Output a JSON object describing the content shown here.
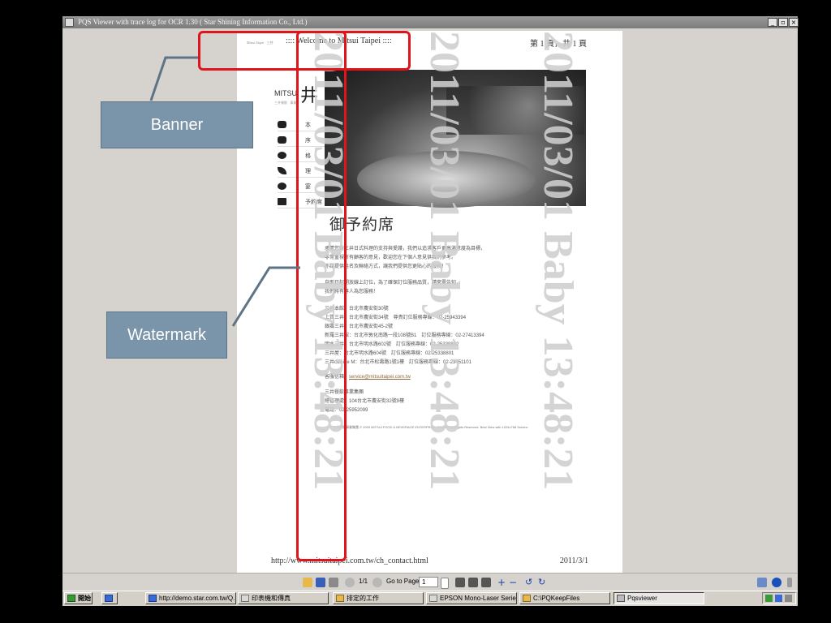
{
  "window": {
    "title": "PQS Viewer with trace log for OCR 1.30 ( Star Shining Information Co., Ltd.)",
    "min": "_",
    "max": "▫",
    "close": "×"
  },
  "document": {
    "welcome": ":::: Welcome to Mitsui Taipei ::::",
    "top_left_text": "Mitsui Taipei · 三井",
    "page_indicator": "第 1 頁，共 1 頁",
    "logo_text": "MITSU",
    "logo_kanji": "井",
    "logo_subtext": "三井餐飲 · 事業",
    "nav_items": [
      {
        "icon": "dish-icon",
        "label": "本"
      },
      {
        "icon": "hand-icon",
        "label": "序"
      },
      {
        "icon": "circle-icon",
        "label": "格"
      },
      {
        "icon": "leaf-icon",
        "label": "理"
      },
      {
        "icon": "ball-icon",
        "label": "宴"
      },
      {
        "icon": "card-icon",
        "label": "予約席"
      }
    ],
    "section_title": "御予約席",
    "paragraphs": [
      "承蒙您對三井日式料理的支持與愛護，我們以追求客戶更高滿意度為目標，",
      "非常重視所有顧客的意見，歡迎您在下個人意見供我們參考。",
      "亦請提供姓名及聯絡方式，讓我們提供您更貼心的服務！",
      "",
      "自即日起開放線上訂位，為了確保訂位服務品質，請來電告知，",
      "我們將有專人為您服務！",
      "",
      "三井本館：台北市農安街30號",
      "上質三井：台北市農安街34號　尊貴訂位服務專線：02-25943394",
      "銀壽三井：台北市農安街45-2號",
      "新羅三井館：台北市敦化南路一段108號B1　訂位服務專線：02-27413394",
      "明水三井：台北市明水路602號　訂位服務專線：02-25338802",
      "三井屋：台北市明水路604號　訂位服務專線：02-25338801",
      "三井cuisine M：台北市松壽路1號1樓　訂位服務專線：02-23451101"
    ],
    "service_label": "客服信箱：",
    "service_email": "service@mitsuitaipei.com.tw",
    "company_lines": [
      "三井餐飲事業集團",
      "總管理處：104台北市農安街32號9樓",
      "電話：02-25952099"
    ],
    "copyright": "三井餐飲事業集團 © 2009 MITSUI FOOD & BEVERAGE ENTERPRISE GROUP. All Rights Reserved. Best View with 1024x768 Screen.",
    "footer_url": "http://www.mitsuitaipei.com.tw/ch_contact.html",
    "footer_date": "2011/3/1",
    "watermark": "2011/03/01 Baby 13:48:21"
  },
  "annotations": {
    "banner_label": "Banner",
    "watermark_label": "Watermark",
    "box_color": "#e0141b",
    "callout_color": "#7a94aa"
  },
  "toolbar": {
    "page_display": "1/1",
    "goto_label": "Go to Page",
    "goto_value": "1"
  },
  "taskbar": {
    "start": "開始",
    "tasks": [
      "http://demo.star.com.tw/Q...",
      "印表機和傳真",
      "排定的工作",
      "EPSON Mono-Laser Series2",
      "C:\\PQKeepFiles",
      "Pqsviewer"
    ]
  }
}
